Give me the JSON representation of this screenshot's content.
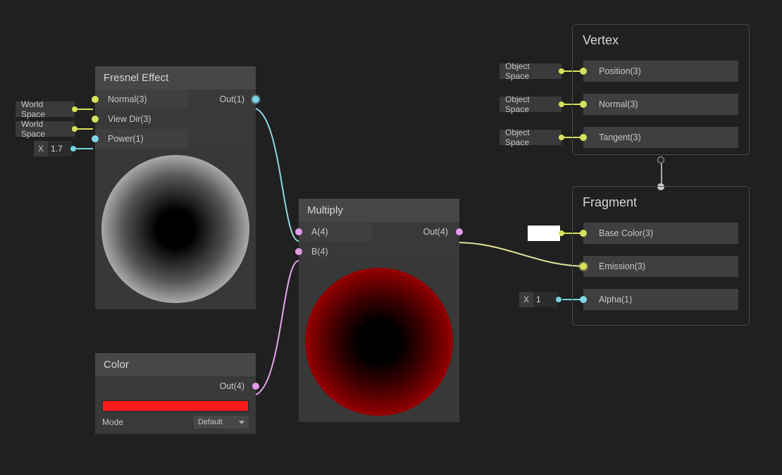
{
  "fresnel": {
    "title": "Fresnel Effect",
    "normal": "Normal(3)",
    "viewdir": "View Dir(3)",
    "power": "Power(1)",
    "out": "Out(1)",
    "chip_normal": "World Space",
    "chip_viewdir": "World Space",
    "chip_power_x": "X",
    "chip_power_val": "1.7"
  },
  "color": {
    "title": "Color",
    "out": "Out(4)",
    "mode_label": "Mode",
    "mode_value": "Default",
    "swatch": "#ff1a1a"
  },
  "multiply": {
    "title": "Multiply",
    "a": "A(4)",
    "b": "B(4)",
    "out": "Out(4)"
  },
  "vertex": {
    "title": "Vertex",
    "position": "Position(3)",
    "normal": "Normal(3)",
    "tangent": "Tangent(3)",
    "chip": "Object Space"
  },
  "fragment": {
    "title": "Fragment",
    "basecolor": "Base Color(3)",
    "emission": "Emission(3)",
    "alpha": "Alpha(1)",
    "alpha_chip_x": "X",
    "alpha_chip_val": "1"
  }
}
